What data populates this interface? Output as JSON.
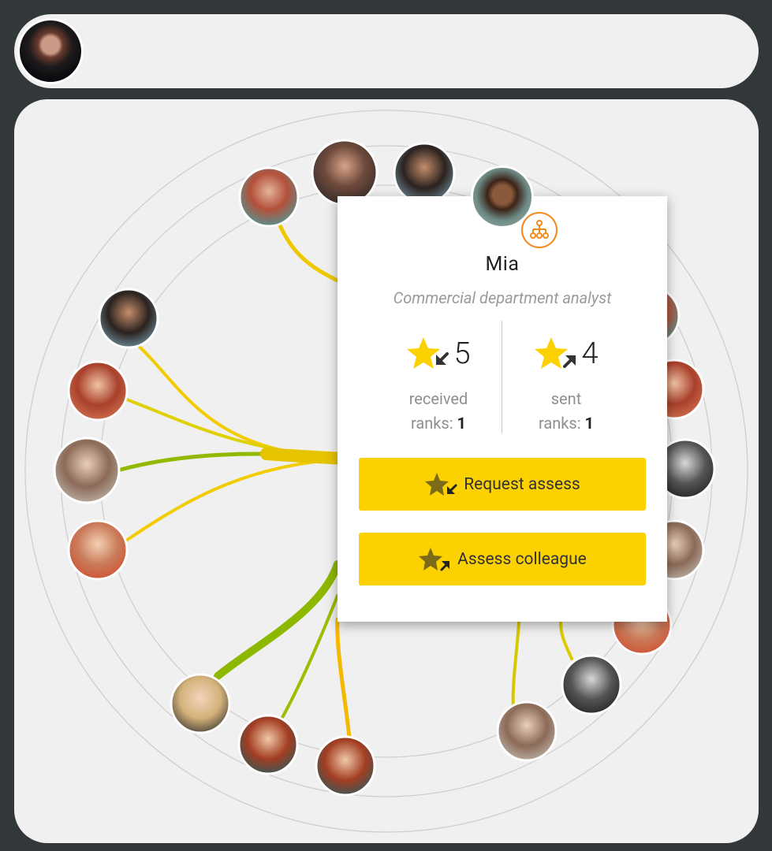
{
  "header": {
    "user_avatar": "user-avatar"
  },
  "profile": {
    "name": "Mia",
    "role": "Commercial department analyst",
    "received": {
      "count": "5",
      "ranks_label": "ranks:",
      "ranks_value": "1",
      "label": "received"
    },
    "sent": {
      "count": "4",
      "ranks_label": "ranks:",
      "ranks_value": "1",
      "label": "sent"
    },
    "actions": {
      "request": "Request assess",
      "assess": "Assess colleague"
    },
    "badge_icon": "org-structure-icon"
  },
  "colors": {
    "accent_yellow": "#fbd100",
    "link_yellow": "#f5cf00",
    "link_green": "#8fb900",
    "badge_orange": "#f08a1d",
    "card_bg": "#ffffff",
    "panel_bg": "#f0f0f0",
    "page_bg": "#32373a"
  }
}
